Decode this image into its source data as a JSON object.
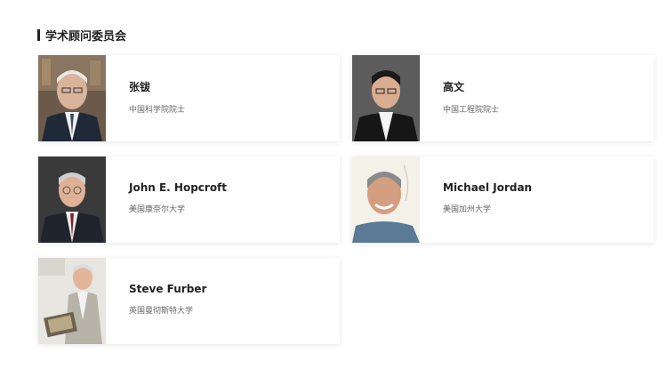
{
  "section": {
    "title": "学术顾问委员会"
  },
  "members": [
    {
      "name": "张钹",
      "title": "中国科学院院士",
      "photo": "portrait-zhang-bo"
    },
    {
      "name": "高文",
      "title": "中国工程院院士",
      "photo": "portrait-gao-wen"
    },
    {
      "name": "John E. Hopcroft",
      "title": "美国康奈尔大学",
      "photo": "portrait-john-hopcroft"
    },
    {
      "name": "Michael Jordan",
      "title": "美国加州大学",
      "photo": "portrait-michael-jordan"
    },
    {
      "name": "Steve Furber",
      "title": "英国曼彻斯特大学",
      "photo": "portrait-steve-furber"
    }
  ]
}
